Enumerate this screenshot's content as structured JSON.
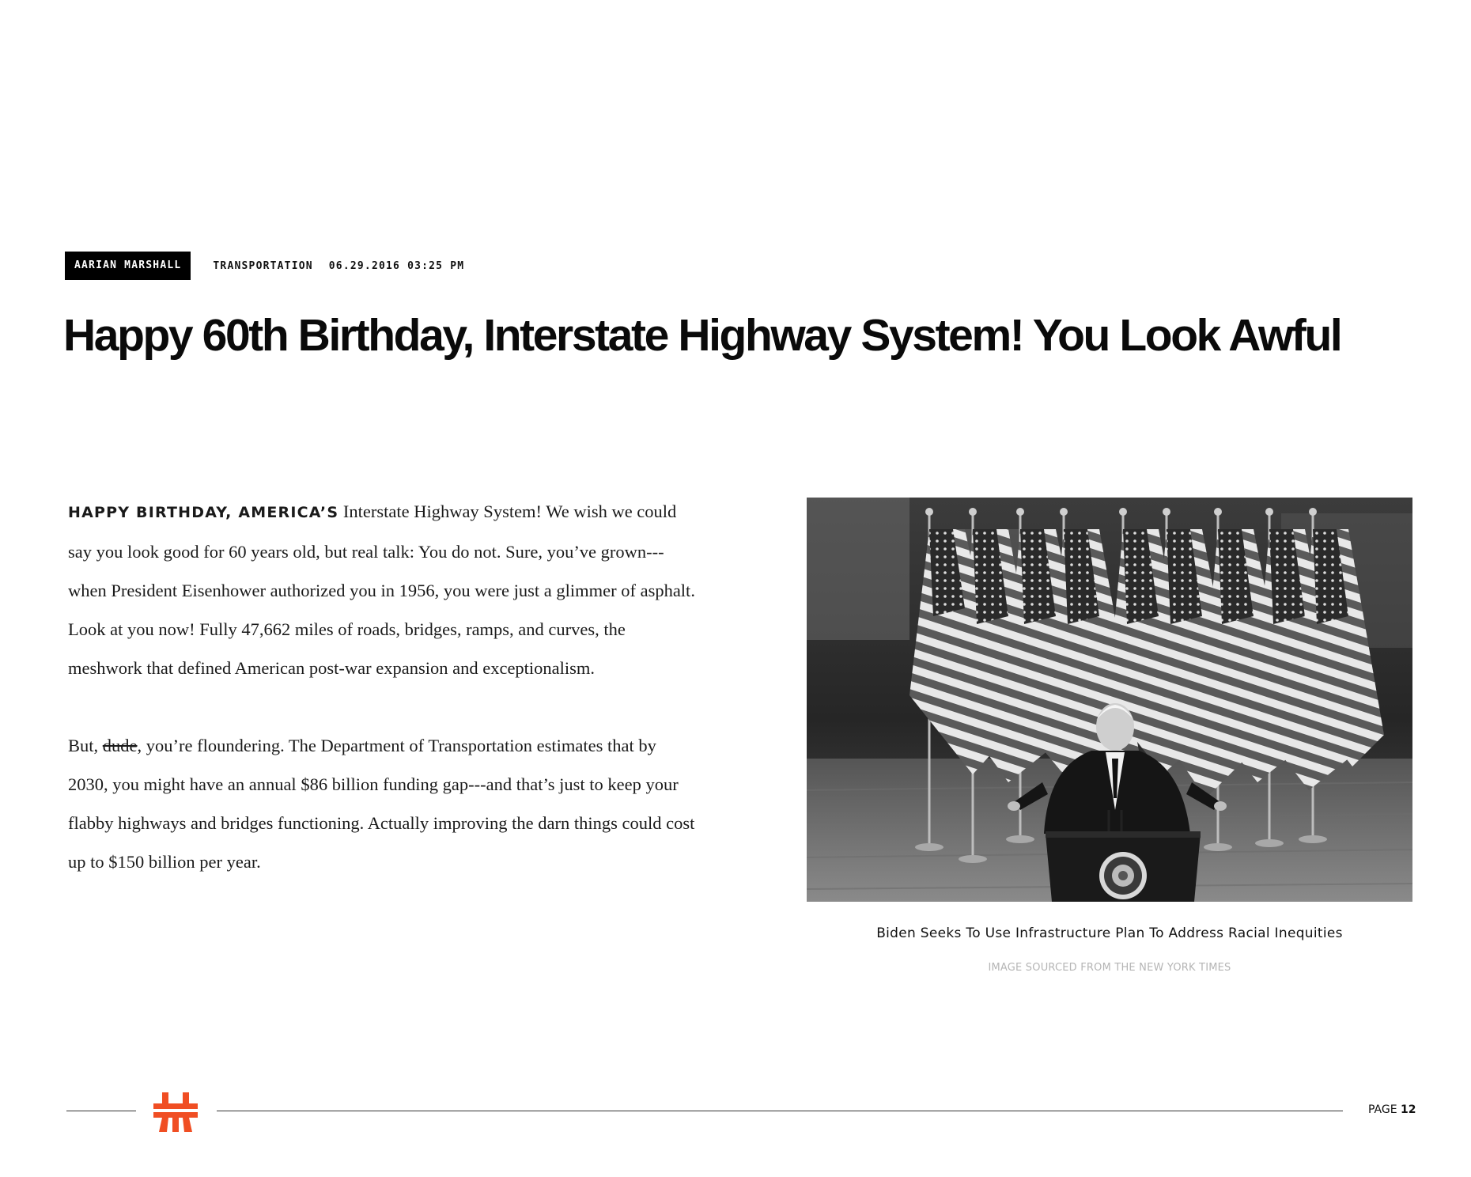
{
  "meta": {
    "author": "AARIAN MARSHALL",
    "section": "TRANSPORTATION",
    "datetime": "06.29.2016 03:25 PM"
  },
  "headline": "Happy 60th Birthday, Interstate Highway System! You Look Awful",
  "article": {
    "p1_leadin": "HAPPY BIRTHDAY, AMERICA’S",
    "p1_text": " Interstate Highway System! We wish we could say you look good for 60 years old, but real talk: You do not. Sure, you’ve grown---when President Eisenhower authorized you in 1956, you were just a glimmer of asphalt. Look at you now! Fully 47,662 miles of roads, bridges, ramps, and curves, the meshwork that defined American post-war expansion and exceptionalism.",
    "p2_before": "But, ",
    "p2_struck": "dude",
    "p2_after": ", you’re floundering. The Department of Transportation estimates that by 2030, you might have an annual $86 billion funding gap---and that’s just to keep your flabby highways and bridges functioning. Actually improving the darn things could cost up to $150 billion per year."
  },
  "figure": {
    "caption": "Biden Seeks To Use Infrastructure Plan To Address Racial Inequities",
    "credit": "IMAGE SOURCED FROM THE NEW YORK TIMES"
  },
  "footer": {
    "page_label": "PAGE",
    "page_number": "12",
    "logo_icon": "highway-logo-icon",
    "logo_color": "#f04e23"
  }
}
